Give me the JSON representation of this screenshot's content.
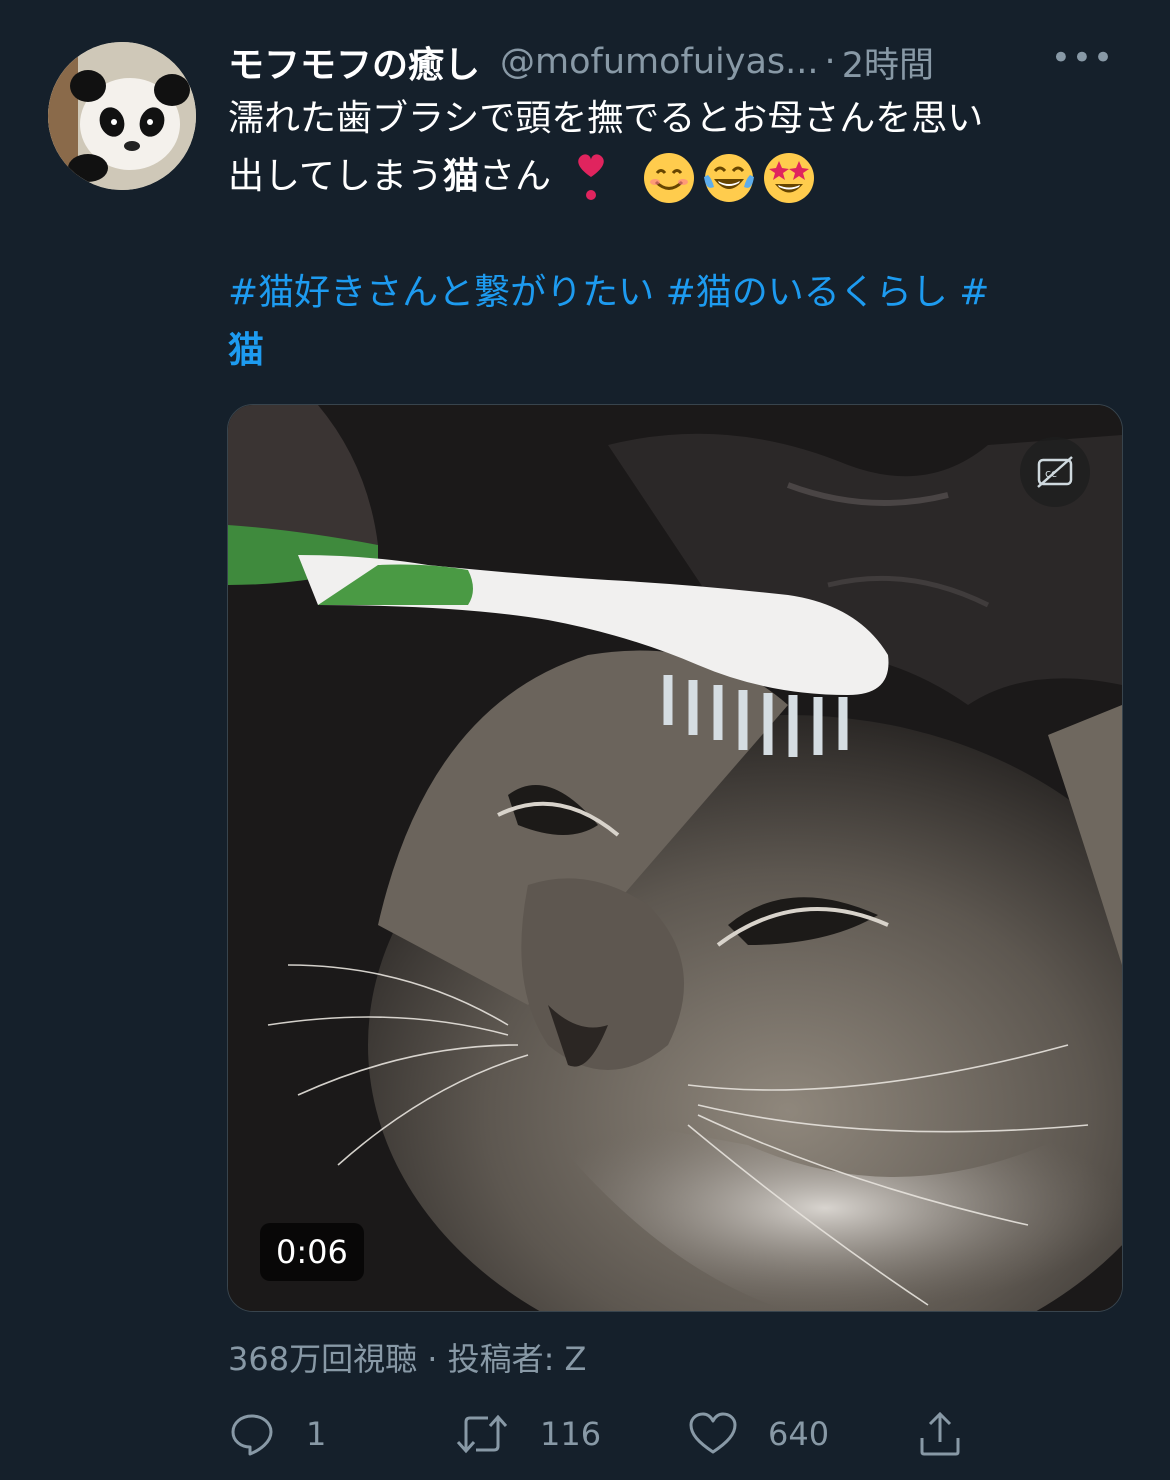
{
  "author": {
    "display_name": "モフモフの癒し",
    "handle": "@mofumofuiyas...",
    "separator": "·",
    "time": "2時間",
    "avatar_icon": "panda-avatar"
  },
  "more_label": "•••",
  "body": {
    "line1": "濡れた歯ブラシで頭を撫でるとお母さんを思い",
    "line2_text": "出してしまう",
    "line2_bold": "猫",
    "line2_tail": "さん",
    "emojis": [
      "heavy-heart-exclamation-icon",
      "smiling-face-icon",
      "tears-of-joy-icon",
      "star-struck-icon"
    ]
  },
  "hashtags": {
    "line1": "#猫好きさんと繋がりたい #猫のいるくらし #",
    "line2": "猫"
  },
  "video": {
    "duration": "0:06",
    "captions_icon": "captions-off-icon"
  },
  "views_text": "368万回視聴 · 投稿者: Z",
  "actions": {
    "reply_count": "1",
    "retweet_count": "116",
    "like_count": "640"
  },
  "colors": {
    "background": "#15202b",
    "link": "#1d9bf0",
    "secondary_text": "#8899a6"
  }
}
